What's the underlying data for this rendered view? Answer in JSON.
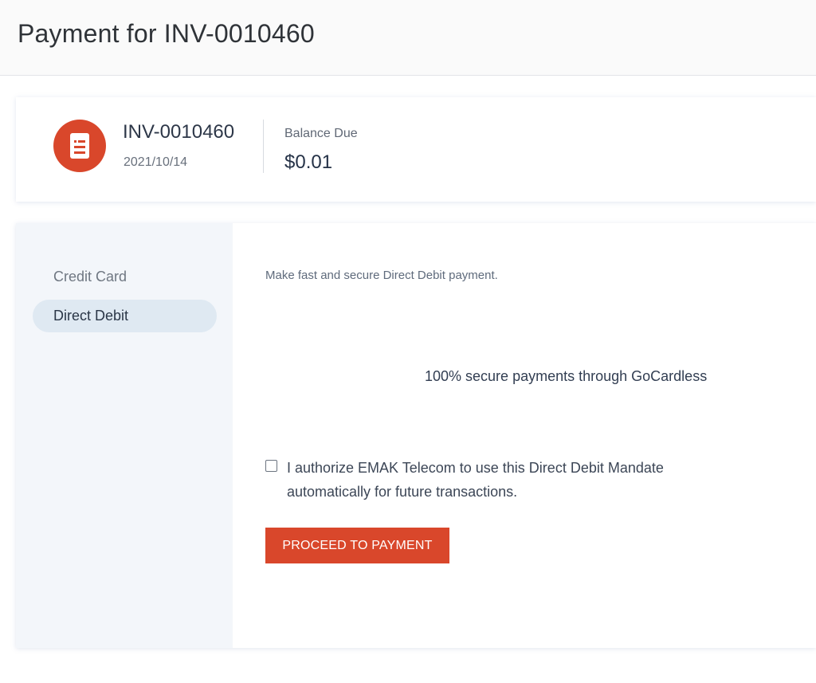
{
  "header": {
    "title": "Payment for INV-0010460"
  },
  "invoice": {
    "icon": "document-icon",
    "number": "INV-0010460",
    "date": "2021/10/14",
    "balance_label": "Balance Due",
    "balance_value": "$0.01"
  },
  "payment_methods": {
    "items": [
      {
        "label": "Credit Card",
        "selected": false
      },
      {
        "label": "Direct Debit",
        "selected": true
      }
    ]
  },
  "direct_debit": {
    "intro": "Make fast and secure Direct Debit payment.",
    "secure_note": "100% secure payments through GoCardless",
    "authorize_checked": false,
    "authorize_text": "I authorize EMAK Telecom to use this Direct Debit Mandate automatically for future transactions.",
    "proceed_label": "PROCEED TO PAYMENT"
  },
  "colors": {
    "accent": "#d9472b",
    "sidebar_bg": "#f3f6fa",
    "selected_nav_bg": "#dfe9f2"
  }
}
